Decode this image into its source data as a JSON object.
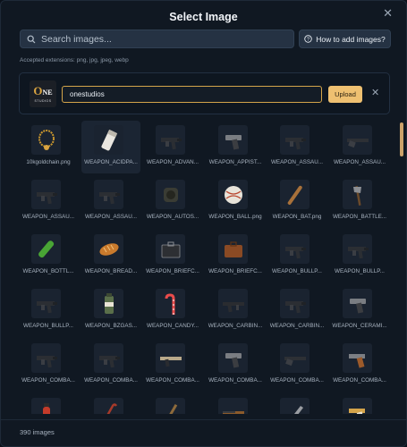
{
  "dialog": {
    "title": "Select Image"
  },
  "search": {
    "placeholder": "Search images..."
  },
  "help_button": {
    "label": "How to add images?"
  },
  "accepted_text": "Accepted extensions: png, jpg, jpeg, webp",
  "upload": {
    "logo": {
      "big_letter": "O",
      "small_letters": "NE",
      "tagline": "STUDIOS"
    },
    "name_value": "onestudios",
    "button_label": "Upload"
  },
  "images": [
    {
      "label": "10kgoldchain.png",
      "icon": "gold-chain",
      "selected": false
    },
    {
      "label": "WEAPON_ACIDPA...",
      "icon": "acid-package",
      "selected": true
    },
    {
      "label": "WEAPON_ADVAN...",
      "icon": "smg",
      "selected": false
    },
    {
      "label": "WEAPON_APPIST...",
      "icon": "pistol",
      "selected": false
    },
    {
      "label": "WEAPON_ASSAU...",
      "icon": "smg",
      "selected": false
    },
    {
      "label": "WEAPON_ASSAU...",
      "icon": "shotgun",
      "selected": false
    },
    {
      "label": "WEAPON_ASSAU...",
      "icon": "smg",
      "selected": false
    },
    {
      "label": "WEAPON_ASSAU...",
      "icon": "smg",
      "selected": false
    },
    {
      "label": "WEAPON_AUTOS...",
      "icon": "grenade-launcher",
      "selected": false
    },
    {
      "label": "WEAPON_BALL.png",
      "icon": "ball",
      "selected": false
    },
    {
      "label": "WEAPON_BAT.png",
      "icon": "bat",
      "selected": false
    },
    {
      "label": "WEAPON_BATTLE...",
      "icon": "axe",
      "selected": false
    },
    {
      "label": "WEAPON_BOTTL...",
      "icon": "bottle",
      "selected": false
    },
    {
      "label": "WEAPON_BREAD...",
      "icon": "bread",
      "selected": false
    },
    {
      "label": "WEAPON_BRIEFC...",
      "icon": "briefcase",
      "selected": false
    },
    {
      "label": "WEAPON_BRIEFC...",
      "icon": "briefcase-brown",
      "selected": false
    },
    {
      "label": "WEAPON_BULLP...",
      "icon": "smg",
      "selected": false
    },
    {
      "label": "WEAPON_BULLP...",
      "icon": "smg",
      "selected": false
    },
    {
      "label": "WEAPON_BULLP...",
      "icon": "smg",
      "selected": false
    },
    {
      "label": "WEAPON_BZGAS...",
      "icon": "gas-canister",
      "selected": false
    },
    {
      "label": "WEAPON_CANDY...",
      "icon": "candy-cane",
      "selected": false
    },
    {
      "label": "WEAPON_CARBIN...",
      "icon": "rifle",
      "selected": false
    },
    {
      "label": "WEAPON_CARBIN...",
      "icon": "smg",
      "selected": false
    },
    {
      "label": "WEAPON_CERAMI...",
      "icon": "pistol",
      "selected": false
    },
    {
      "label": "WEAPON_COMBA...",
      "icon": "smg",
      "selected": false
    },
    {
      "label": "WEAPON_COMBA...",
      "icon": "smg",
      "selected": false
    },
    {
      "label": "WEAPON_COMBA...",
      "icon": "rifle-tan",
      "selected": false
    },
    {
      "label": "WEAPON_COMBA...",
      "icon": "pistol",
      "selected": false
    },
    {
      "label": "WEAPON_COMBA...",
      "icon": "shotgun",
      "selected": false
    },
    {
      "label": "WEAPON_COMBA...",
      "icon": "revolver-wood",
      "selected": false
    },
    {
      "label": "",
      "icon": "fire-extinguisher",
      "selected": false
    },
    {
      "label": "",
      "icon": "crowbar",
      "selected": false
    },
    {
      "label": "",
      "icon": "dagger",
      "selected": false
    },
    {
      "label": "",
      "icon": "shotgun-wood",
      "selected": false
    },
    {
      "label": "",
      "icon": "machete",
      "selected": false
    },
    {
      "label": "",
      "icon": "revolver-gold",
      "selected": false
    }
  ],
  "footer": {
    "count_text": "390 images"
  },
  "colors": {
    "accent": "#eec071",
    "input_border": "#d4a44a",
    "panel": "#101822"
  }
}
